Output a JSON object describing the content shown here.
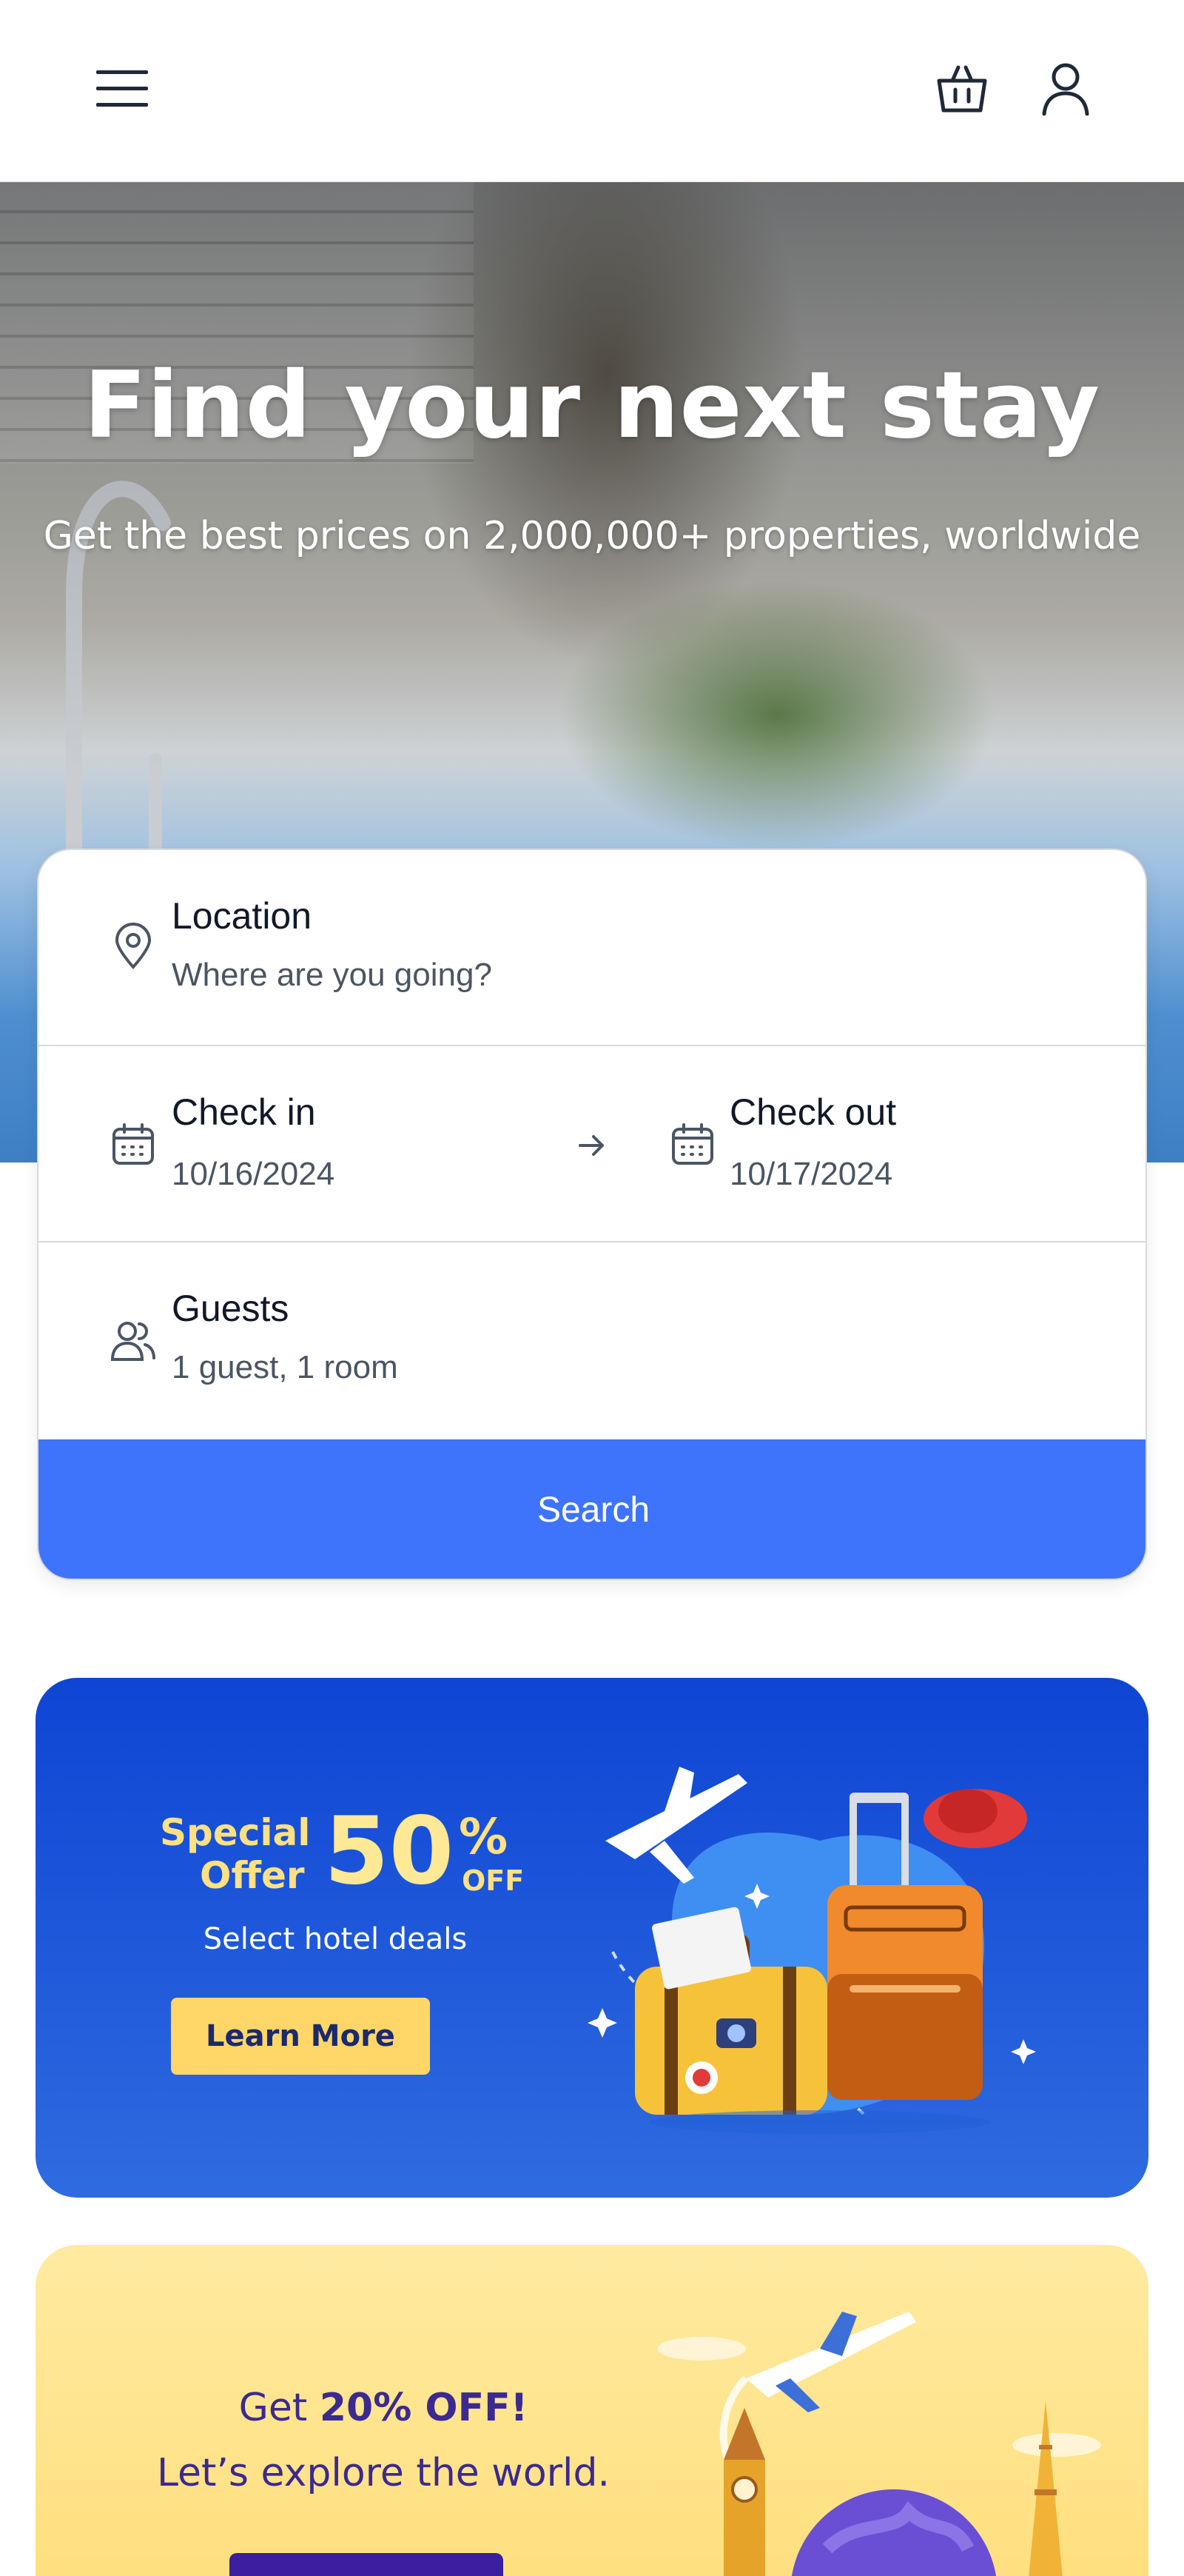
{
  "header": {
    "menu_icon": "hamburger-menu-icon",
    "cart_icon": "basket-icon",
    "account_icon": "user-icon"
  },
  "hero": {
    "title": "Find your next stay",
    "subtitle": "Get the best prices on 2,000,000+ properties, worldwide"
  },
  "search": {
    "location": {
      "label": "Location",
      "placeholder": "Where are you going?",
      "icon": "map-pin-icon"
    },
    "check_in": {
      "label": "Check in",
      "value": "10/16/2024",
      "icon": "calendar-icon"
    },
    "check_out": {
      "label": "Check out",
      "value": "10/17/2024",
      "icon": "calendar-icon"
    },
    "arrow_icon": "arrow-right-icon",
    "guests": {
      "label": "Guests",
      "value": "1 guest, 1 room",
      "icon": "users-icon"
    },
    "button_label": "Search"
  },
  "promo_special": {
    "line1": "Special",
    "line2": "Offer",
    "percent": "50",
    "percent_sign": "%",
    "off": "OFF",
    "subtitle": "Select hotel deals",
    "button_label": "Learn More"
  },
  "promo_world": {
    "prefix": "Get ",
    "highlight": "20% OFF!",
    "line2": "Let’s explore the world."
  },
  "colors": {
    "accent": "#3e74fb",
    "promo_blue": "#0e45d4",
    "promo_yellow": "#ffde7a",
    "cta_yellow": "#ffd667",
    "purple_text": "#3b2a8f"
  }
}
